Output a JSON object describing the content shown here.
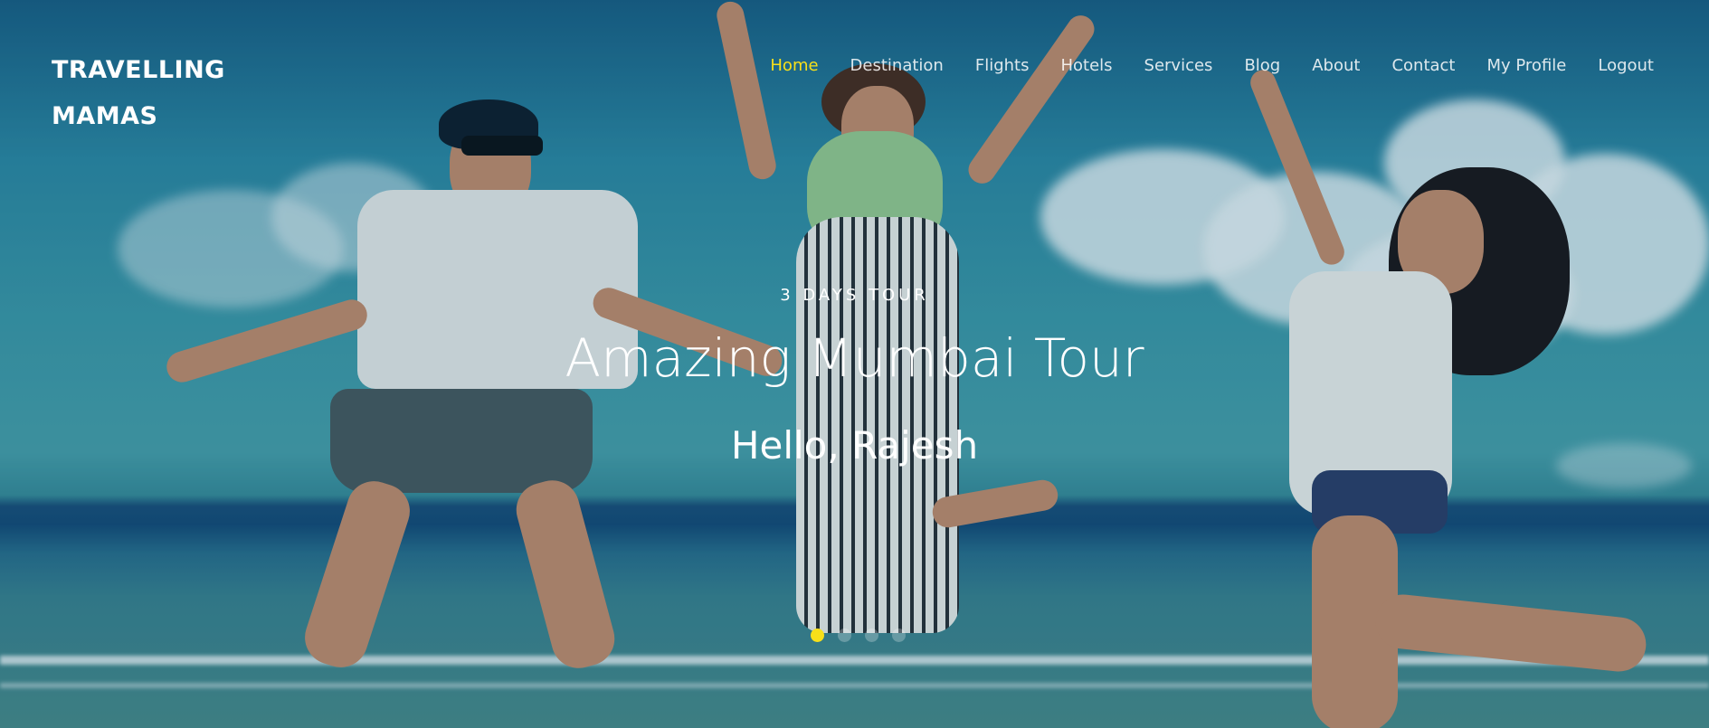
{
  "brand": {
    "line1": "TRAVELLING",
    "line2": "MAMAS"
  },
  "nav": {
    "items": [
      {
        "label": "Home",
        "active": true
      },
      {
        "label": "Destination",
        "active": false
      },
      {
        "label": "Flights",
        "active": false
      },
      {
        "label": "Hotels",
        "active": false
      },
      {
        "label": "Services",
        "active": false
      },
      {
        "label": "Blog",
        "active": false
      },
      {
        "label": "About",
        "active": false
      },
      {
        "label": "Contact",
        "active": false
      },
      {
        "label": "My Profile",
        "active": false
      },
      {
        "label": "Logout",
        "active": false
      }
    ],
    "active_color": "#f7e01a"
  },
  "hero": {
    "subtitle": "3 DAYS TOUR",
    "title": "Amazing Mumbai Tour",
    "greeting": "Hello, Rajesh"
  },
  "slider": {
    "slide_count": 4,
    "active_index": 0
  }
}
